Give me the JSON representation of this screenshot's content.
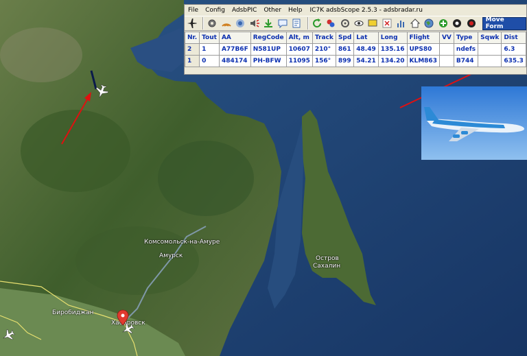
{
  "window": {
    "title": "IC7K adsbScope 2.5.3 - adsbradar.ru",
    "menu": [
      "File",
      "Config",
      "AdsbPIC",
      "Other",
      "Help"
    ]
  },
  "toolbar": {
    "move_form_label": "Move Form",
    "icons": [
      "airplane-icon",
      "gear-icon",
      "radar-icon",
      "antenna-icon",
      "speaker-icon",
      "download-icon",
      "comment-icon",
      "printer-icon",
      "refresh-icon",
      "filter-icon",
      "receiver-icon",
      "eye-icon",
      "display-icon",
      "close-icon",
      "chart-icon",
      "home-icon",
      "map-icon",
      "plus-icon",
      "record-icon",
      "stop-icon"
    ]
  },
  "table": {
    "columns": [
      "Nr.",
      "Tout",
      "AA",
      "RegCode",
      "Alt, m",
      "Track",
      "Spd",
      "Lat",
      "Long",
      "Flight",
      "VV",
      "Type",
      "Sqwk",
      "Dist"
    ],
    "rows": [
      [
        "2",
        "1",
        "A77B6F",
        "N581UP",
        "10607",
        "210°",
        "861",
        "48.49",
        "135.16",
        "UPS80",
        "",
        "ndefs",
        "",
        "6.3"
      ],
      [
        "1",
        "0",
        "484174",
        "PH-BFW",
        "11095",
        "156°",
        "899",
        "54.21",
        "134.20",
        "KLM863",
        "",
        "B744",
        "",
        "635.3"
      ]
    ]
  },
  "map": {
    "labels": {
      "komsomolsk": "Комсомольск-на-Амуре",
      "amursk": "Амурск",
      "sakhalin_1": "Остров",
      "sakhalin_2": "Сахалин",
      "birobidzhan": "Биробиджан",
      "khabarovsk": "Хабаровск"
    }
  },
  "colors": {
    "accent": "#1f4ea8",
    "grid_text": "#0b2fb0",
    "arrow": "#e01010",
    "sea": "#1d3f6e",
    "land": "#4d6a32"
  }
}
